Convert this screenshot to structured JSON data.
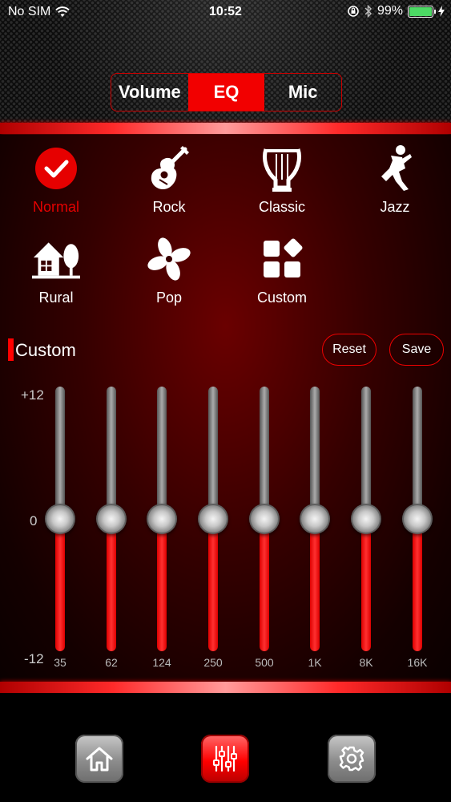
{
  "status": {
    "carrier": "No SIM",
    "time": "10:52",
    "battery": "99%"
  },
  "tabs": [
    {
      "label": "Volume",
      "active": false
    },
    {
      "label": "EQ",
      "active": true
    },
    {
      "label": "Mic",
      "active": false
    }
  ],
  "presets": [
    {
      "label": "Normal",
      "icon": "check-icon",
      "active": true
    },
    {
      "label": "Rock",
      "icon": "guitar-icon",
      "active": false
    },
    {
      "label": "Classic",
      "icon": "lyre-icon",
      "active": false
    },
    {
      "label": "Jazz",
      "icon": "dancer-icon",
      "active": false
    },
    {
      "label": "Rural",
      "icon": "house-tree-icon",
      "active": false
    },
    {
      "label": "Pop",
      "icon": "pinwheel-icon",
      "active": false
    },
    {
      "label": "Custom",
      "icon": "custom-shapes-icon",
      "active": false
    }
  ],
  "custom": {
    "title": "Custom",
    "reset_label": "Reset",
    "save_label": "Save"
  },
  "eq": {
    "scale_max": "+12",
    "scale_mid": "0",
    "scale_min": "-12",
    "range": [
      -12,
      12
    ],
    "bands": [
      {
        "freq": "35",
        "gain": 0
      },
      {
        "freq": "62",
        "gain": 0
      },
      {
        "freq": "124",
        "gain": 0
      },
      {
        "freq": "250",
        "gain": 0
      },
      {
        "freq": "500",
        "gain": 0
      },
      {
        "freq": "1K",
        "gain": 0
      },
      {
        "freq": "8K",
        "gain": 0
      },
      {
        "freq": "16K",
        "gain": 0
      }
    ]
  },
  "nav": [
    {
      "icon": "home-icon"
    },
    {
      "icon": "equalizer-icon",
      "active": true
    },
    {
      "icon": "gear-icon"
    }
  ],
  "colors": {
    "accent": "#f20000",
    "active_preset_label": "#e60000"
  }
}
